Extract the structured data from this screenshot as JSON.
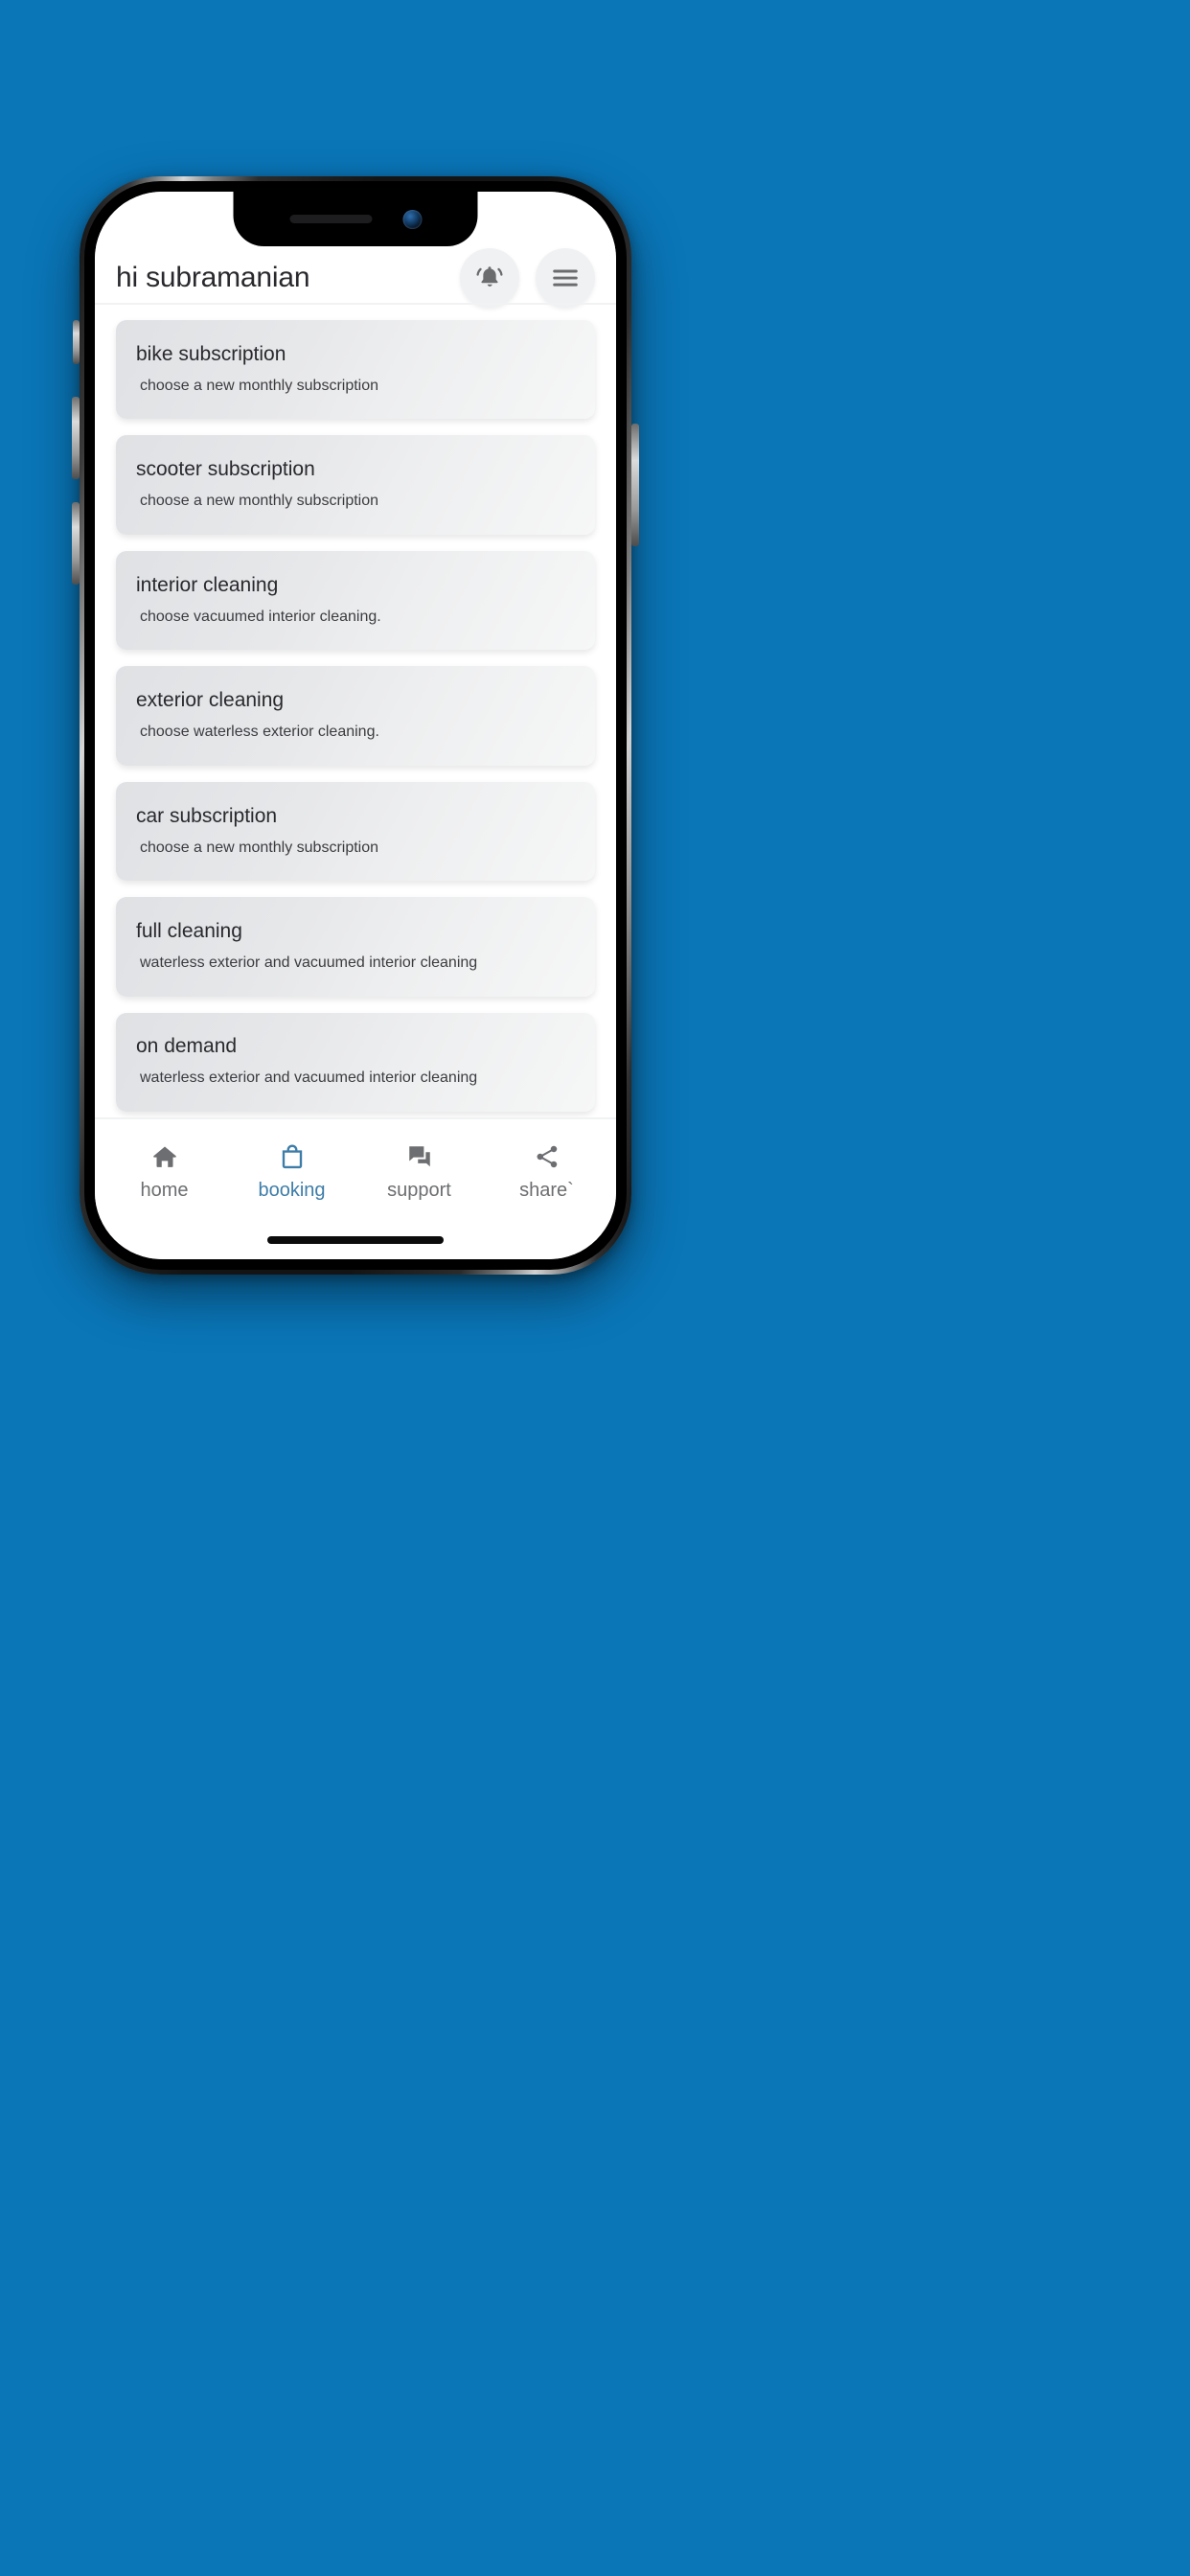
{
  "theme": {
    "background_color": "#0a76b8",
    "card_color": "#e7e8ea",
    "accent_color": "#3e7da8",
    "text_primary": "#29292d",
    "text_secondary": "#3c3c40",
    "nav_inactive": "#6d6e71"
  },
  "header": {
    "greeting": "hi subramanian",
    "notification_icon": "bell-ringing-icon",
    "menu_icon": "hamburger-menu-icon"
  },
  "cards": [
    {
      "title": "bike subscription",
      "subtitle": "choose a new monthly subscription"
    },
    {
      "title": "scooter subscription",
      "subtitle": "choose a new monthly subscription"
    },
    {
      "title": "interior cleaning",
      "subtitle": "choose vacuumed interior cleaning."
    },
    {
      "title": "exterior cleaning",
      "subtitle": "choose waterless exterior cleaning."
    },
    {
      "title": "car subscription",
      "subtitle": "choose a new monthly subscription"
    },
    {
      "title": "full cleaning",
      "subtitle": "waterless exterior and vacuumed interior cleaning"
    },
    {
      "title": "on demand",
      "subtitle": "waterless exterior and vacuumed interior cleaning"
    }
  ],
  "bottom_nav": {
    "items": [
      {
        "label": "home",
        "icon": "home-icon",
        "active": false
      },
      {
        "label": "booking",
        "icon": "shopping-bag-icon",
        "active": true
      },
      {
        "label": "support",
        "icon": "chat-bubbles-icon",
        "active": false
      },
      {
        "label": "share`",
        "icon": "share-nodes-icon",
        "active": false
      }
    ]
  }
}
